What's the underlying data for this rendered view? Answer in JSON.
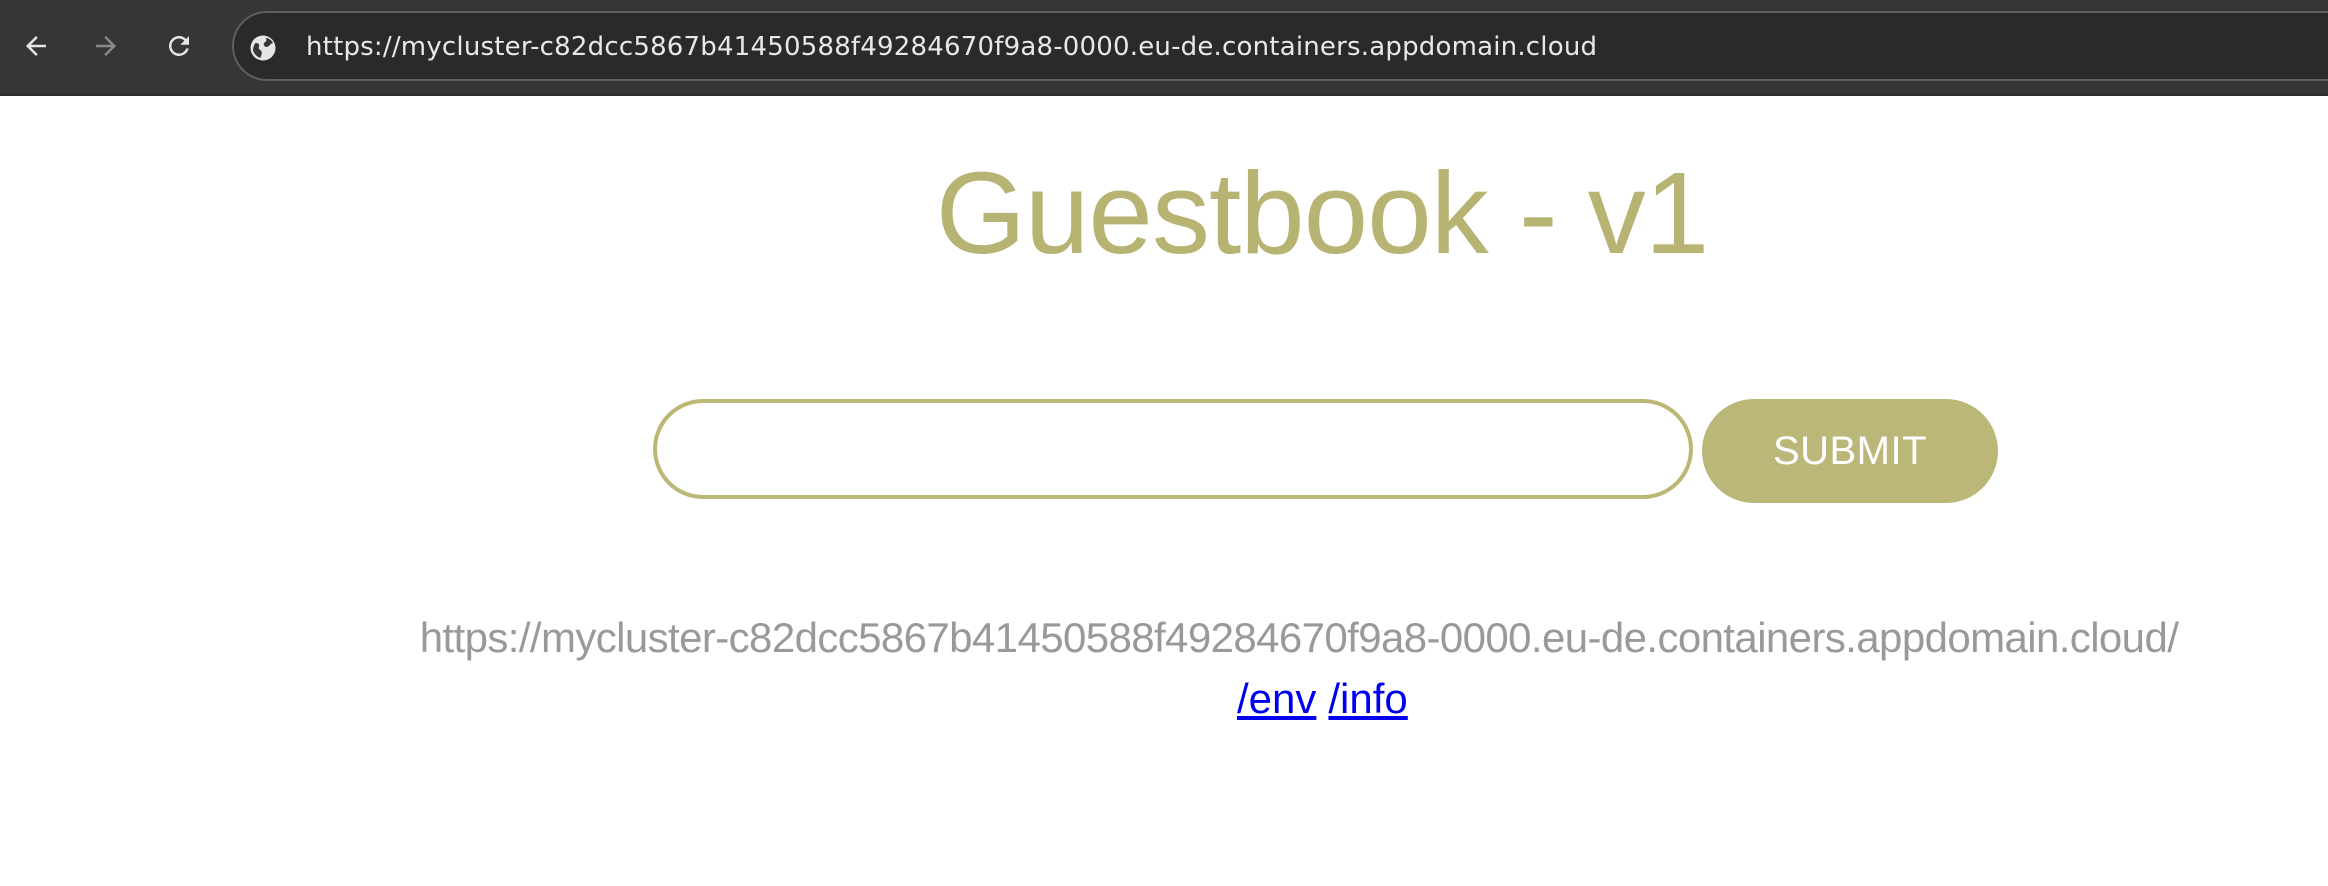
{
  "browser": {
    "back_icon": "arrow-left-icon",
    "forward_icon": "arrow-right-icon",
    "reload_icon": "reload-icon",
    "site_info_icon": "globe-icon",
    "url": "https://mycluster-c82dcc5867b41450588f49284670f9a8-0000.eu-de.containers.appdomain.cloud"
  },
  "page": {
    "title": "Guestbook - v1",
    "input_value": "",
    "submit_label": "SUBMIT",
    "host_address": "https://mycluster-c82dcc5867b41450588f49284670f9a8-0000.eu-de.containers.appdomain.cloud/",
    "links": [
      {
        "label": "/env"
      },
      {
        "label": "/info"
      }
    ]
  },
  "colors": {
    "accent": "#bbb778",
    "title": "#b7b372",
    "host_text": "#999999",
    "link": "#0000ee",
    "toolbar": "#363636"
  }
}
